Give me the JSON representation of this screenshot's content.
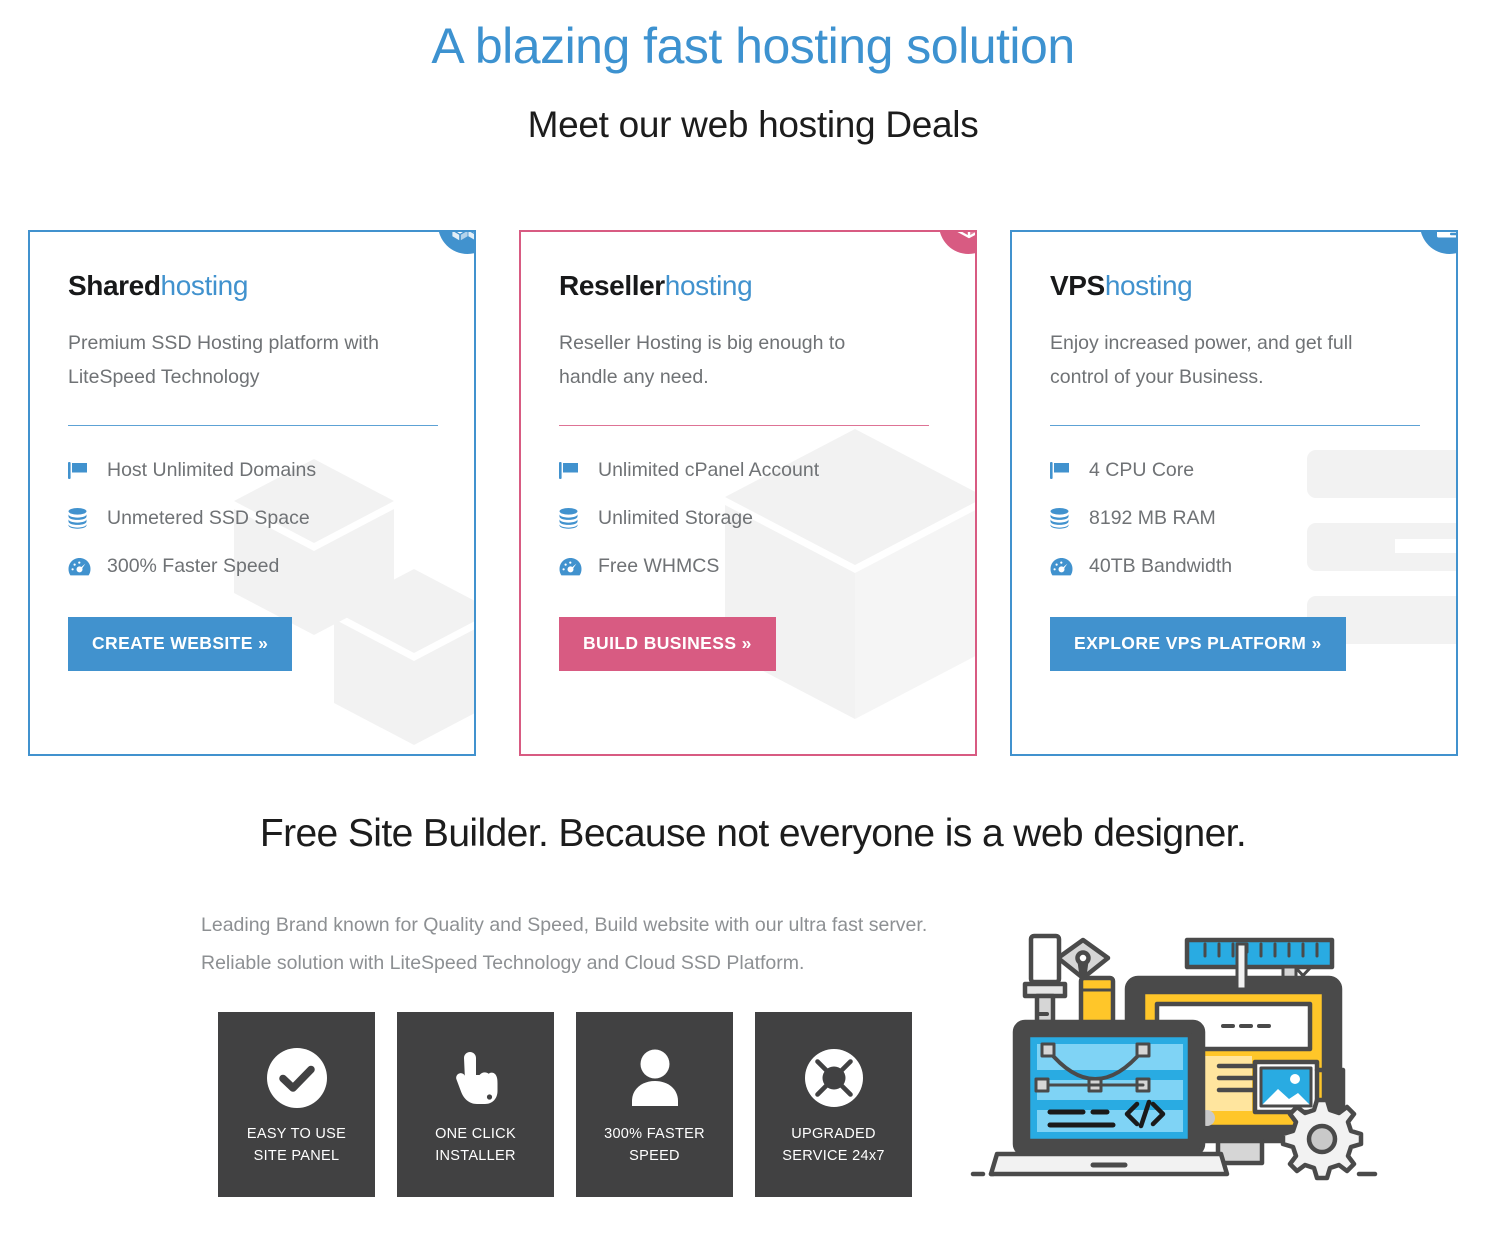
{
  "hero": {
    "title": "A blazing fast hosting solution",
    "subtitle": "Meet our web hosting Deals"
  },
  "colors": {
    "blue": "#4192ce",
    "pink": "#d85b82",
    "tile_dark": "#414142",
    "body_text": "#6f7275"
  },
  "plans": [
    {
      "name_strong": "Shared",
      "name_light": "hosting",
      "description": "Premium SSD Hosting platform with LiteSpeed Technology",
      "badge_icon": "cubes-icon",
      "accent": "#4192ce",
      "features": [
        {
          "icon": "flag-icon",
          "label": "Host Unlimited Domains"
        },
        {
          "icon": "database-icon",
          "label": "Unmetered SSD Space"
        },
        {
          "icon": "tachometer-icon",
          "label": "300% Faster Speed"
        }
      ],
      "cta": "CREATE WEBSITE »"
    },
    {
      "name_strong": "Reseller",
      "name_light": "hosting",
      "description": "Reseller Hosting is big enough to handle any need.",
      "badge_icon": "cube-icon",
      "accent": "#d85b82",
      "features": [
        {
          "icon": "flag-icon",
          "label": "Unlimited cPanel Account"
        },
        {
          "icon": "database-icon",
          "label": "Unlimited Storage"
        },
        {
          "icon": "tachometer-icon",
          "label": "Free WHMCS"
        }
      ],
      "cta": "BUILD BUSINESS »"
    },
    {
      "name_strong": "VPS",
      "name_light": "hosting",
      "description": "Enjoy increased power, and get full control of your Business.",
      "badge_icon": "server-icon",
      "accent": "#4192ce",
      "features": [
        {
          "icon": "flag-icon",
          "label": "4 CPU Core"
        },
        {
          "icon": "database-icon",
          "label": "8192 MB RAM"
        },
        {
          "icon": "tachometer-icon",
          "label": "40TB Bandwidth"
        }
      ],
      "cta": "EXPLORE VPS PLATFORM »"
    }
  ],
  "builder": {
    "title": "Free Site Builder. Because not everyone is a web designer.",
    "lead": "Leading Brand known for Quality and Speed, Build website with our ultra fast server. Reliable solution with LiteSpeed Technology and Cloud SSD Platform.",
    "tiles": [
      {
        "icon": "check-circle-icon",
        "line1": "EASY TO USE",
        "line2": "SITE PANEL"
      },
      {
        "icon": "pointing-hand-icon",
        "line1": "ONE CLICK",
        "line2": "INSTALLER"
      },
      {
        "icon": "user-icon",
        "line1": "300% FASTER",
        "line2": "SPEED"
      },
      {
        "icon": "life-ring-icon",
        "line1": "UPGRADED",
        "line2": "SERVICE 24x7"
      }
    ],
    "illustration": "web-design-workspace-illustration"
  }
}
